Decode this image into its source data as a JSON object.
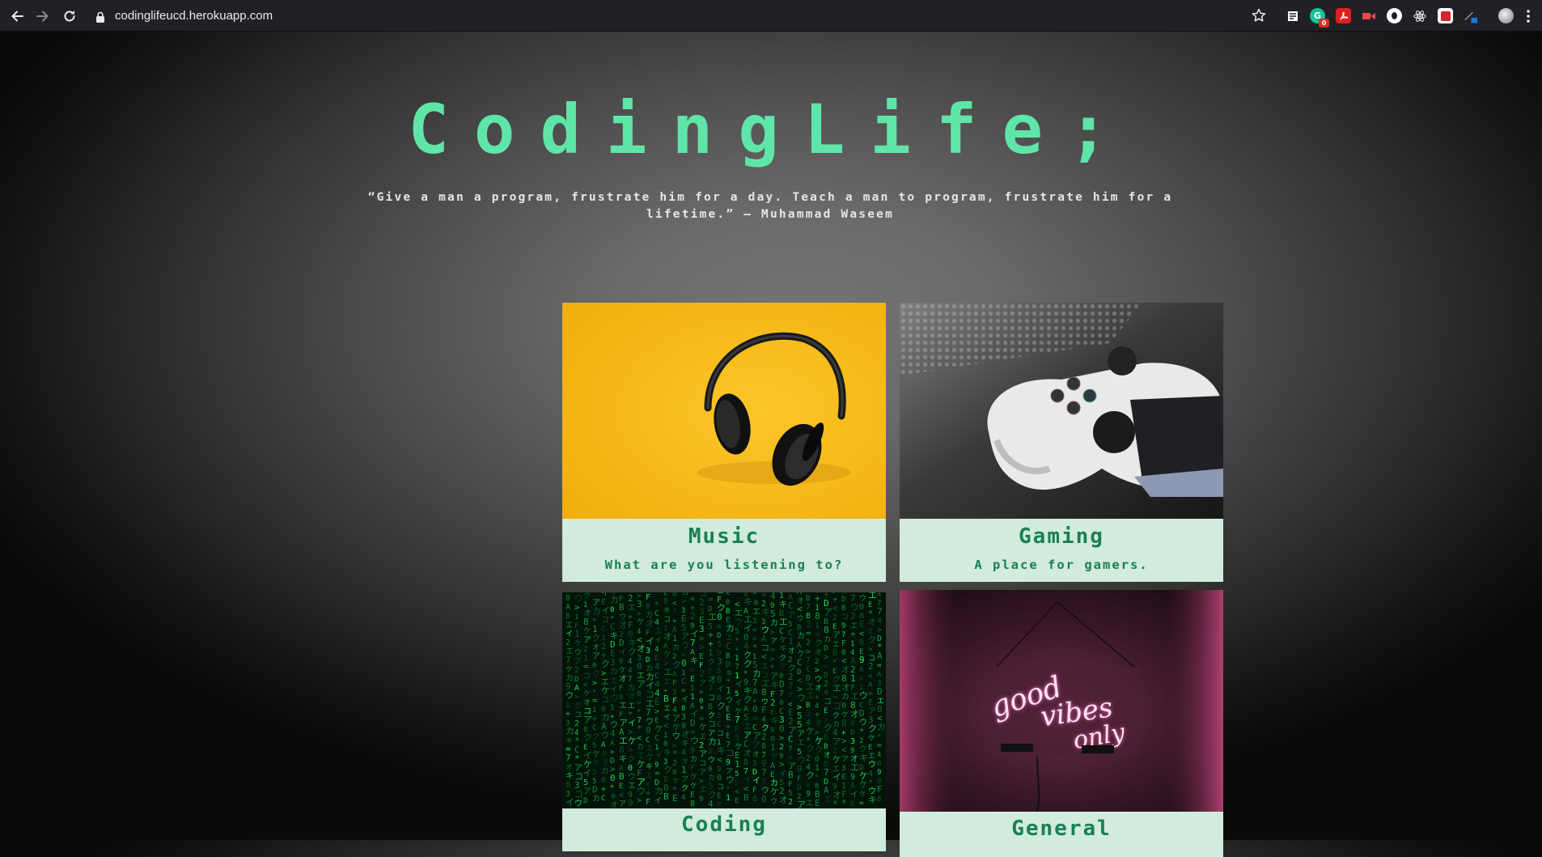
{
  "browser": {
    "url": "codinglifeucd.herokuapp.com",
    "icons": [
      "back-arrow-icon",
      "forward-arrow-icon",
      "reload-icon",
      "lock-icon",
      "bookmark-star-icon",
      "reading-list-icon",
      "grammarly-icon",
      "pdf-icon",
      "screencast-icon",
      "circle-extension-icon",
      "react-devtools-icon",
      "clipper-icon",
      "color-picker-icon",
      "profile-avatar-icon",
      "more-menu-icon"
    ],
    "extension_badge": "0"
  },
  "page": {
    "title": "CodingLife;",
    "quote": "“Give a man a program, frustrate him for a day. Teach a man to program, frustrate him for a lifetime.” – Muhammad Waseem",
    "accent_color": "#5fe5a8",
    "card_text_color": "#1a7f52",
    "card_bg_color": "#d1ebdd"
  },
  "cards": [
    {
      "title": "Music",
      "subtitle": "What are you listening to?",
      "image": "headphones-on-yellow"
    },
    {
      "title": "Gaming",
      "subtitle": "A place for gamers.",
      "image": "white-game-controller"
    },
    {
      "title": "Coding",
      "subtitle": "",
      "image": "green-matrix-code"
    },
    {
      "title": "General",
      "subtitle": "",
      "image": "pink-neon-good-vibes-only"
    }
  ],
  "neon_sign": {
    "line1": "good",
    "line2": "vibes",
    "line3": "only"
  }
}
